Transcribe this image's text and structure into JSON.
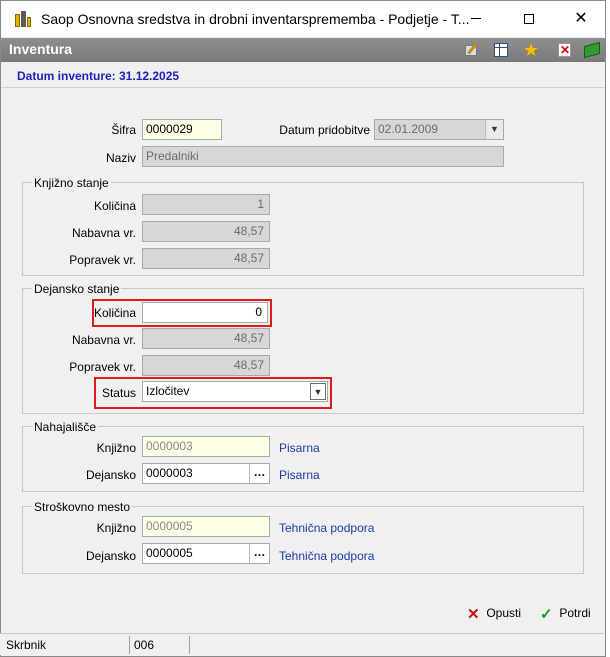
{
  "window": {
    "title": "Saop Osnovna sredstva in drobni inventarsprememba - Podjetje - T...",
    "minimize": "—",
    "maximize": "☐",
    "close": "✕"
  },
  "header": {
    "title": "Inventura",
    "icons": [
      "edit-icon",
      "table-icon",
      "favorite-star-icon",
      "delete-icon",
      "book-icon"
    ]
  },
  "date_label": "Datum inventure: 31.12.2025",
  "form": {
    "sifra_label": "Šifra",
    "sifra_value": "0000029",
    "datum_pridobitve_label": "Datum pridobitve",
    "datum_pridobitve_value": "02.01.2009",
    "naziv_label": "Naziv",
    "naziv_value": "Predalniki"
  },
  "knjizno_stanje": {
    "legend": "Knjižno stanje",
    "kolicina_label": "Količina",
    "kolicina_value": "1",
    "nabavna_label": "Nabavna vr.",
    "nabavna_value": "48,57",
    "popravek_label": "Popravek vr.",
    "popravek_value": "48,57"
  },
  "dejansko_stanje": {
    "legend": "Dejansko stanje",
    "kolicina_label": "Količina",
    "kolicina_value": "0",
    "nabavna_label": "Nabavna vr.",
    "nabavna_value": "48,57",
    "popravek_label": "Popravek vr.",
    "popravek_value": "48,57",
    "status_label": "Status",
    "status_value": "Izločitev"
  },
  "nahajalisce": {
    "legend": "Nahajališče",
    "knjizno_label": "Knjižno",
    "knjizno_value": "0000003",
    "knjizno_name": "Pisarna",
    "dejansko_label": "Dejansko",
    "dejansko_value": "0000003",
    "dejansko_name": "Pisarna"
  },
  "stroskovno_mesto": {
    "legend": "Stroškovno mesto",
    "knjizno_label": "Knjižno",
    "knjizno_value": "0000005",
    "knjizno_name": "Tehnična podpora",
    "dejansko_label": "Dejansko",
    "dejansko_value": "0000005",
    "dejansko_name": "Tehnična podpora"
  },
  "buttons": {
    "cancel_label": "Opusti",
    "confirm_label": "Potrdi"
  },
  "statusbar": {
    "label": "Skrbnik",
    "value": "006"
  },
  "colors": {
    "highlight_border": "#e01b1b",
    "link": "#1c3aa9",
    "date_text": "#1c23b8"
  }
}
